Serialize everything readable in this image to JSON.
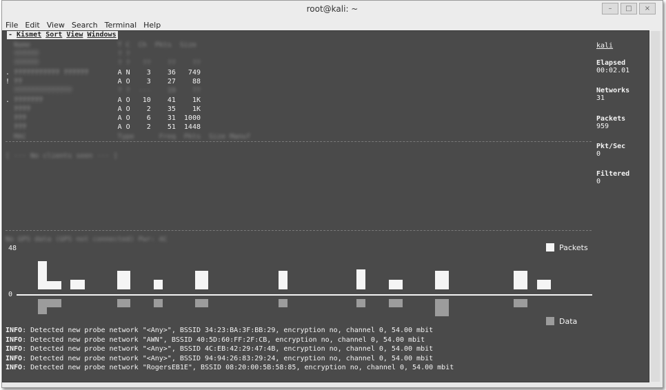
{
  "window": {
    "title": "root@kali: ~",
    "min": "–",
    "max": "□",
    "close": "×"
  },
  "menu": [
    "File",
    "Edit",
    "View",
    "Search",
    "Terminal",
    "Help"
  ],
  "kismet_menu": {
    "first": "Kismet",
    "items": [
      "Sort",
      "View",
      "Windows"
    ]
  },
  "network_header": "  Name                     T C  Ch  Pkts  Size",
  "networks": [
    {
      "flag": " ",
      "name": "??????",
      "t": "?",
      "c": "?",
      "ch": "",
      "pkts": "",
      "size": "",
      "blur": true
    },
    {
      "flag": " ",
      "name": "??????",
      "t": "?",
      "c": "?",
      "ch": "??",
      "pkts": "??",
      "size": "??",
      "blur": true
    },
    {
      "flag": ".",
      "name": "??????????? ??????",
      "t": "A",
      "c": "N",
      "ch": "3",
      "pkts": "36",
      "size": "749",
      "blur": false
    },
    {
      "flag": "!",
      "name": "??",
      "t": "A",
      "c": "O",
      "ch": "3",
      "pkts": "27",
      "size": "88",
      "blur": false
    },
    {
      "flag": " ",
      "name": "??????????????",
      "t": "?",
      "c": "?",
      "ch": "---",
      "pkts": "19",
      "size": "??",
      "blur": true
    },
    {
      "flag": ".",
      "name": "???????",
      "t": "A",
      "c": "O",
      "ch": "10",
      "pkts": "41",
      "size": "1K",
      "blur": false
    },
    {
      "flag": " ",
      "name": "????",
      "t": "A",
      "c": "O",
      "ch": "2",
      "pkts": "35",
      "size": "1K",
      "blur": false
    },
    {
      "flag": " ",
      "name": "???",
      "t": "A",
      "c": "O",
      "ch": "6",
      "pkts": "31",
      "size": "1000",
      "blur": false
    },
    {
      "flag": " ",
      "name": "???",
      "t": "A",
      "c": "O",
      "ch": "2",
      "pkts": "51",
      "size": "1448",
      "blur": false
    }
  ],
  "client_header": "  MAC                      Type      Freq  Pkts  Size Manuf",
  "no_clients": "[ --- No clients seen --- ]",
  "gps_status": "No GPS data (GPS not connected) Pwr: AC",
  "side": {
    "host": "kali",
    "elapsed_label": "Elapsed",
    "elapsed": "00:02.01",
    "networks_label": "Networks",
    "networks": "31",
    "packets_label": "Packets",
    "packets": "959",
    "pktsec_label": "Pkt/Sec",
    "pktsec": "0",
    "filtered_label": "Filtered",
    "filtered": "0"
  },
  "graph": {
    "ymax_label": "48",
    "zero_label": "0",
    "legend_packets": "Packets",
    "legend_data": "Data",
    "colors": {
      "packets": "#f5f5f5",
      "data": "#9c9c9c",
      "background": "#4a4a4a"
    }
  },
  "info_lines": [
    {
      "tag": "INFO",
      "text": ": Detected new probe network \"<Any>\", BSSID 34:23:BA:3F:BB:29, encryption no, channel 0, 54.00 mbit"
    },
    {
      "tag": "INFO",
      "text": ": Detected new probe network \"AWN\", BSSID 40:5D:60:FF:2F:CB, encryption no, channel 0, 54.00 mbit"
    },
    {
      "tag": "INFO",
      "text": ": Detected new probe network \"<Any>\", BSSID 4C:EB:42:29:47:4B, encryption no, channel 0, 54.00 mbit"
    },
    {
      "tag": "INFO",
      "text": ": Detected new probe network \"<Any>\", BSSID 94:94:26:83:29:24, encryption no, channel 0, 54.00 mbit"
    },
    {
      "tag": "INFO",
      "text": ": Detected new probe network \"RogersEB1E\", BSSID 08:20:00:5B:58:85, encryption no, channel 0, 54.00 mbit"
    }
  ]
}
